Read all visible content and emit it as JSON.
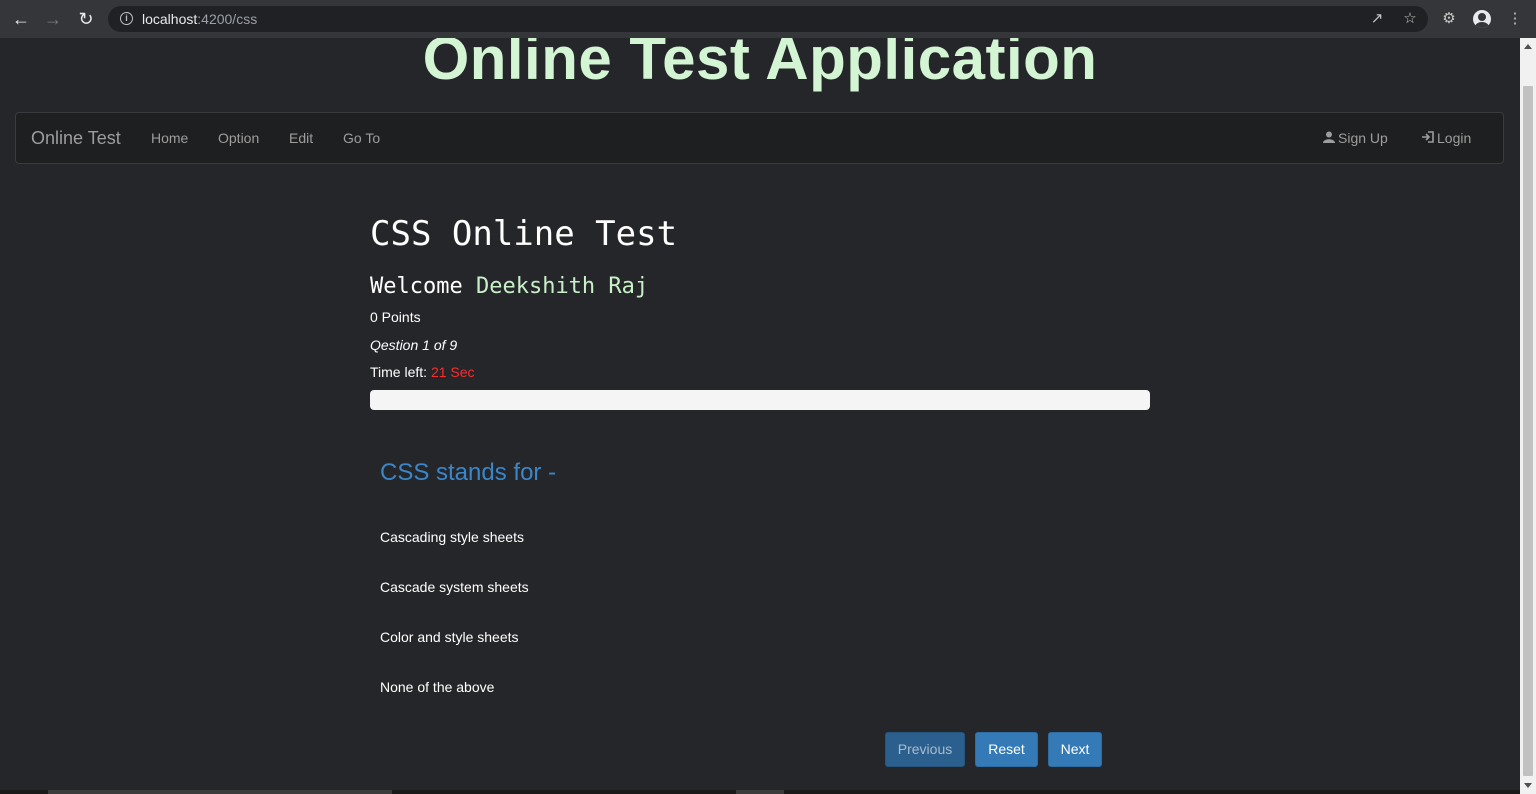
{
  "browser": {
    "url_host": "localhost",
    "url_path": ":4200/css"
  },
  "page": {
    "app_title": "Online Test Application",
    "navbar": {
      "brand": "Online Test",
      "links": [
        "Home",
        "Option",
        "Edit",
        "Go To"
      ],
      "signup": "Sign Up",
      "login": "Login"
    },
    "test_title": "CSS Online Test",
    "welcome_prefix": "Welcome",
    "username": "Deekshith Raj",
    "points": "0 Points",
    "question_count": "Qestion 1 of 9",
    "time_left_label": "Time left:",
    "time_left_value": "21 Sec",
    "progress_fraction": 0,
    "question": "CSS stands for -",
    "options": [
      "Cascading style sheets",
      "Cascade system sheets",
      "Color and style sheets",
      "None of the above"
    ],
    "buttons": {
      "previous": "Previous",
      "reset": "Reset",
      "next": "Next"
    }
  },
  "colors": {
    "app_title": "#d4f5d4",
    "username": "#c8f0c8",
    "time_value": "#ff2a2a",
    "question": "#3a86c8",
    "button": "#337ab7"
  }
}
